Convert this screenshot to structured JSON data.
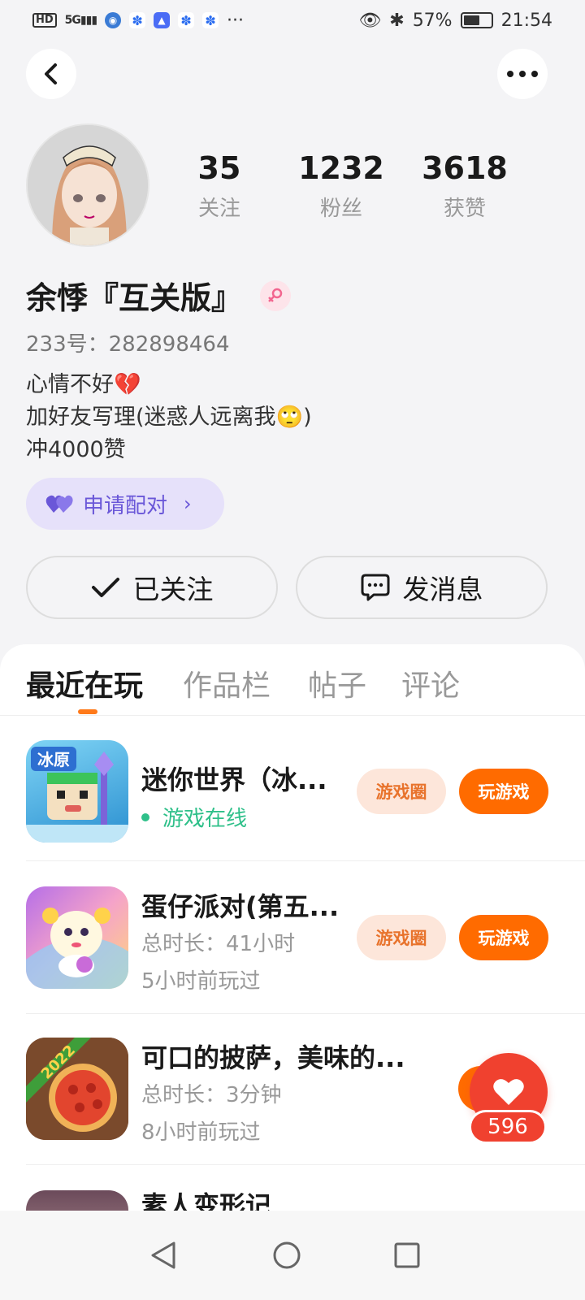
{
  "status_bar": {
    "network": "5G",
    "battery": "57%",
    "time": "21:54",
    "more": "···"
  },
  "profile": {
    "stats": [
      {
        "value": "35",
        "label": "关注"
      },
      {
        "value": "1232",
        "label": "粉丝"
      },
      {
        "value": "3618",
        "label": "获赞"
      }
    ],
    "name": "余悸『互关版』",
    "id_line": "233号：282898464",
    "bio": [
      "心情不好💔",
      "加好友写理(迷惑人远离我🙄)",
      "冲4000赞"
    ],
    "pair_button": "申请配对",
    "follow_button": "已关注",
    "message_button": "发消息"
  },
  "tabs": [
    "最近在玩",
    "作品栏",
    "帖子",
    "评论"
  ],
  "games": [
    {
      "title": "迷你世界（冰...",
      "status": "游戏在线",
      "circle": "游戏圈",
      "play": "玩游戏"
    },
    {
      "title": "蛋仔派对(第五...",
      "duration": "总时长：41小时",
      "last_played": "5小时前玩过",
      "circle": "游戏圈",
      "play": "玩游戏"
    },
    {
      "title": "可口的披萨，美味的...",
      "duration": "总时长：3分钟",
      "last_played": "8小时前玩过"
    },
    {
      "title": "素人变形记"
    }
  ],
  "icon_labels": {
    "mini_world": "冰原",
    "pizza": "2022"
  },
  "like": {
    "count": "596"
  },
  "colors": {
    "accent": "#ff6b00",
    "like": "#f0412f",
    "online": "#2fc08a",
    "pair": "#6a57d8"
  }
}
